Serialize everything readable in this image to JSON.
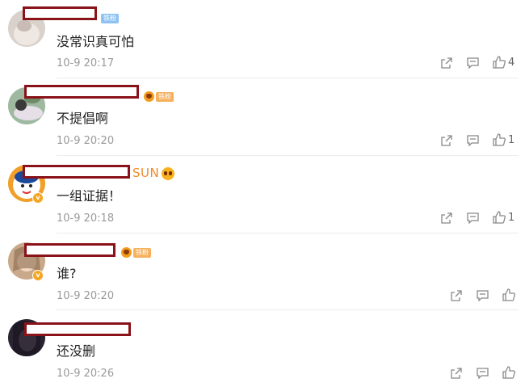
{
  "comments": [
    {
      "text": "没常识真可怕",
      "time": "10-9 20:17",
      "likes": "4",
      "badge": "铁粉"
    },
    {
      "text": "不提倡啊",
      "time": "10-9 20:20",
      "likes": "1",
      "badge": "铁粉"
    },
    {
      "text": "一组证据！",
      "time": "10-9 20:18",
      "likes": "1",
      "name_suffix": "SUN",
      "verified": "v"
    },
    {
      "text": "谁?",
      "time": "10-9 20:20",
      "likes": "",
      "badge": "铁粉",
      "verified": "v"
    },
    {
      "text": "还没删",
      "time": "10-9 20:26",
      "likes": ""
    }
  ],
  "icons": {
    "share": "share-icon",
    "reply": "reply-icon",
    "like": "thumbs-up-icon"
  },
  "colors": {
    "redact_border": "#8a1219",
    "fan_badge": "#f6b15e",
    "verified": "#f5a623"
  }
}
